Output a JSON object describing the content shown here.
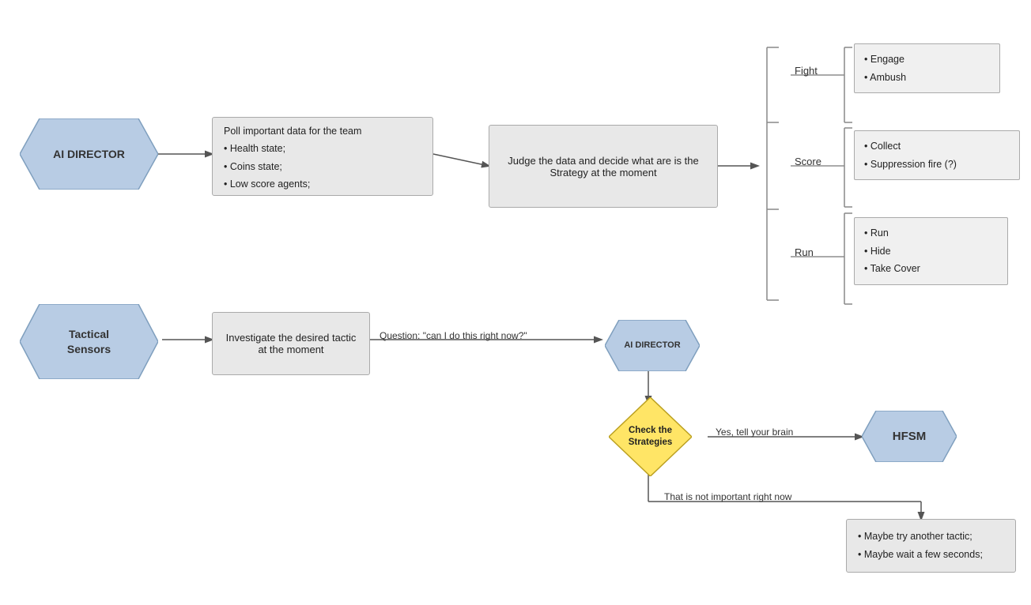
{
  "nodes": {
    "ai_director": {
      "label": "AI DIRECTOR"
    },
    "poll_box": {
      "title": "Poll important data for the team",
      "items": [
        "Health state;",
        "Coins state;",
        "Low score agents;"
      ]
    },
    "judge_box": {
      "text": "Judge the data and decide what are is the Strategy at the moment"
    },
    "tactical_sensors": {
      "label": "Tactical\nSensors"
    },
    "investigate_box": {
      "text": "Investigate the desired tactic at the moment"
    },
    "ai_director2": {
      "label": "AI DIRECTOR"
    },
    "check_diamond": {
      "text": "Check the\nStrategies"
    },
    "hfsm": {
      "label": "HFSM"
    },
    "fallback_box": {
      "items": [
        "Maybe try another tactic;",
        "Maybe wait a few seconds;"
      ]
    }
  },
  "strategy_groups": {
    "fight": {
      "bullet": "Fight",
      "items": [
        "Engage",
        "Ambush"
      ]
    },
    "score": {
      "bullet": "Score",
      "items": [
        "Collect",
        "Suppression fire (?)"
      ]
    },
    "run": {
      "bullet": "Run",
      "items": [
        "Run",
        "Hide",
        "Take Cover"
      ]
    }
  },
  "arrows": {
    "question_label": "Question: \"can I do this right now?\"",
    "yes_label": "Yes, tell your brain",
    "not_important_label": "That is not important right now"
  }
}
